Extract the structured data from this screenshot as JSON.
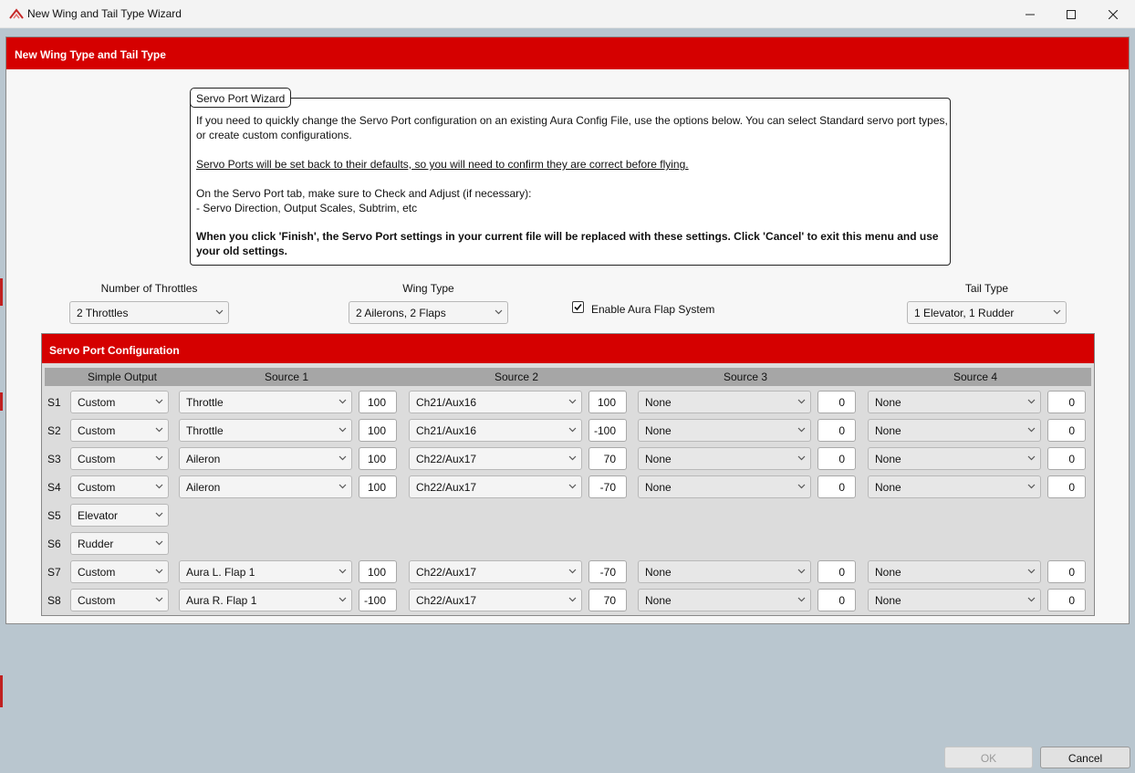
{
  "window": {
    "title": "New Wing and Tail Type Wizard",
    "accent_color": "#d50000"
  },
  "main_header": "New Wing Type and Tail Type",
  "wizard": {
    "legend": "Servo Port Wizard",
    "line1": "If you need to quickly change the Servo Port configuration on an existing Aura Config File, use the options below. You can select Standard servo port types,",
    "line2": "or create custom configurations.",
    "warning": "Servo Ports will be set back to their defaults, so you will need to confirm they are correct before flying.",
    "line3": "On the Servo Port tab, make sure to Check and Adjust (if necessary):",
    "line4": "- Servo Direction, Output Scales, Subtrim, etc",
    "bold1": "When you click 'Finish', the Servo Port settings in your current file will be replaced with these settings. Click 'Cancel' to exit this menu and use",
    "bold2": "your old settings."
  },
  "throttles": {
    "label": "Number of Throttles",
    "value": "2 Throttles"
  },
  "wing_type": {
    "label": "Wing Type",
    "value": "2 Ailerons, 2 Flaps"
  },
  "flap_system": {
    "label": "Enable Aura Flap System",
    "checked": true
  },
  "tail_type": {
    "label": "Tail Type",
    "value": "1 Elevator, 1 Rudder"
  },
  "servo": {
    "header": "Servo Port Configuration",
    "columns": [
      "Simple Output",
      "Source 1",
      "Source 2",
      "Source 3",
      "Source 4"
    ],
    "rows": [
      {
        "port": "S1",
        "output": "Custom",
        "sources": [
          {
            "name": "Throttle",
            "gain": "100"
          },
          {
            "name": "Ch21/Aux16",
            "gain": "100"
          },
          {
            "name": "None",
            "gain": "0"
          },
          {
            "name": "None",
            "gain": "0"
          }
        ]
      },
      {
        "port": "S2",
        "output": "Custom",
        "sources": [
          {
            "name": "Throttle",
            "gain": "100"
          },
          {
            "name": "Ch21/Aux16",
            "gain": "-100"
          },
          {
            "name": "None",
            "gain": "0"
          },
          {
            "name": "None",
            "gain": "0"
          }
        ]
      },
      {
        "port": "S3",
        "output": "Custom",
        "sources": [
          {
            "name": "Aileron",
            "gain": "100"
          },
          {
            "name": "Ch22/Aux17",
            "gain": "70"
          },
          {
            "name": "None",
            "gain": "0"
          },
          {
            "name": "None",
            "gain": "0"
          }
        ]
      },
      {
        "port": "S4",
        "output": "Custom",
        "sources": [
          {
            "name": "Aileron",
            "gain": "100"
          },
          {
            "name": "Ch22/Aux17",
            "gain": "-70"
          },
          {
            "name": "None",
            "gain": "0"
          },
          {
            "name": "None",
            "gain": "0"
          }
        ]
      },
      {
        "port": "S5",
        "output": "Elevator",
        "sources": []
      },
      {
        "port": "S6",
        "output": "Rudder",
        "sources": []
      },
      {
        "port": "S7",
        "output": "Custom",
        "sources": [
          {
            "name": "Aura L. Flap 1",
            "gain": "100"
          },
          {
            "name": "Ch22/Aux17",
            "gain": "-70"
          },
          {
            "name": "None",
            "gain": "0"
          },
          {
            "name": "None",
            "gain": "0"
          }
        ]
      },
      {
        "port": "S8",
        "output": "Custom",
        "sources": [
          {
            "name": "Aura R. Flap 1",
            "gain": "-100"
          },
          {
            "name": "Ch22/Aux17",
            "gain": "70"
          },
          {
            "name": "None",
            "gain": "0"
          },
          {
            "name": "None",
            "gain": "0"
          }
        ]
      }
    ]
  },
  "buttons": {
    "ok": "OK",
    "cancel": "Cancel"
  }
}
